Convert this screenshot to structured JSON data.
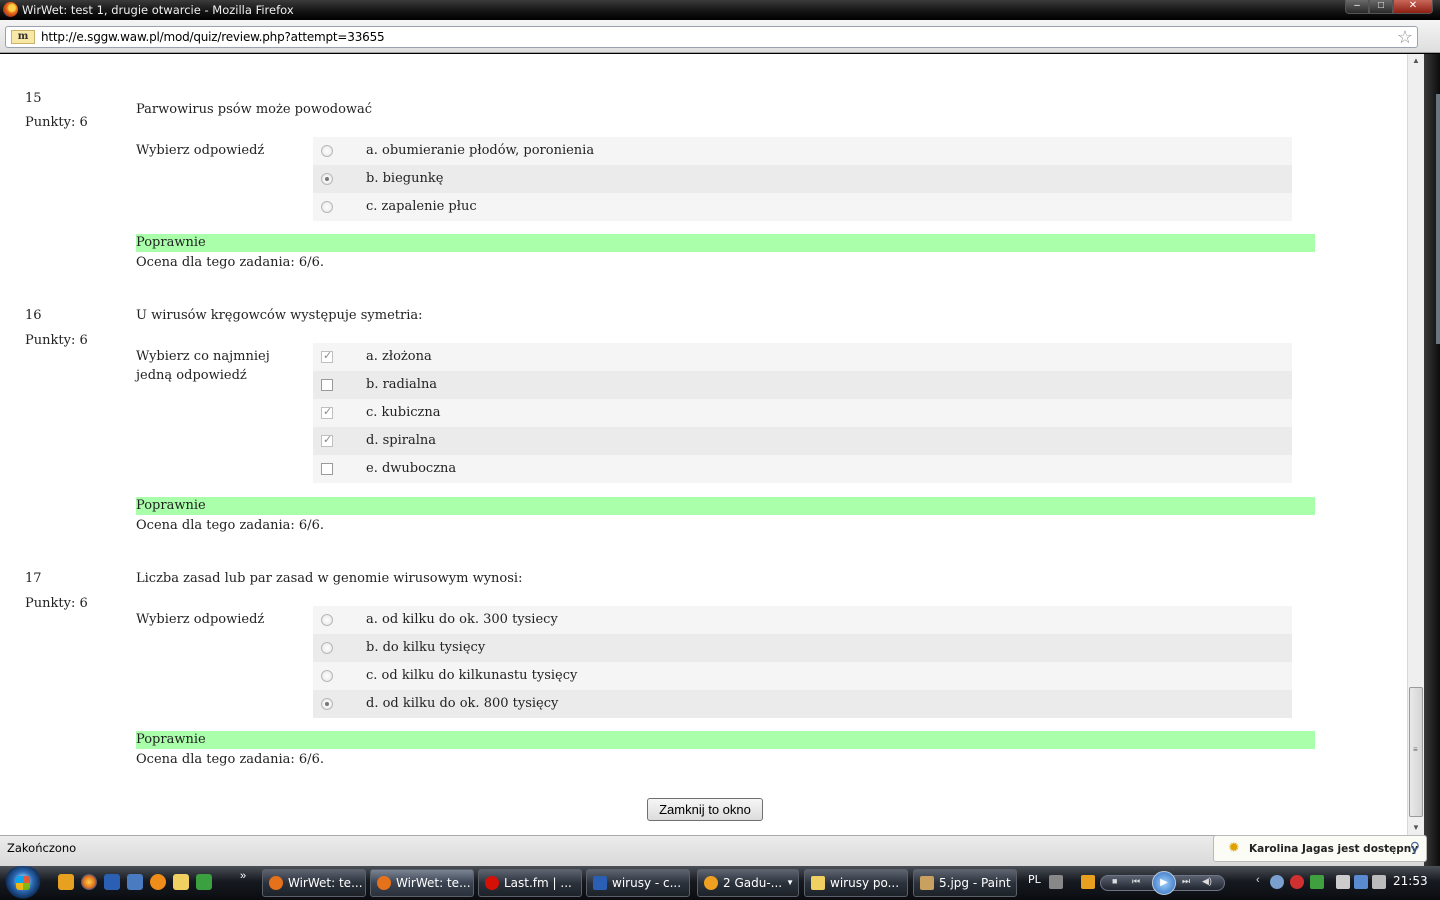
{
  "window": {
    "title": "WirWet: test 1, drugie otwarcie - Mozilla Firefox"
  },
  "address_bar": {
    "url": "http://e.sggw.waw.pl/mod/quiz/review.php?attempt=33655",
    "site_icon": "m"
  },
  "questions": [
    {
      "number": "15",
      "points": "Punkty: 6",
      "text": "Parwowirus psów może powodować",
      "prompt": "Wybierz odpowiedź",
      "type": "radio",
      "answers": [
        {
          "label": "a. obumieranie płodów, poronienia",
          "selected": false
        },
        {
          "label": "b. biegunkę",
          "selected": true
        },
        {
          "label": "c. zapalenie płuc",
          "selected": false
        }
      ],
      "feedback": "Poprawnie",
      "grade": "Ocena dla tego zadania: 6/6."
    },
    {
      "number": "16",
      "points": "Punkty: 6",
      "text": "U wirusów kręgowców występuje symetria:",
      "prompt": "Wybierz co najmniej jedną odpowiedź",
      "type": "checkbox",
      "answers": [
        {
          "label": "a. złożona",
          "selected": true
        },
        {
          "label": "b. radialna",
          "selected": false
        },
        {
          "label": "c. kubiczna",
          "selected": true
        },
        {
          "label": "d. spiralna",
          "selected": true
        },
        {
          "label": "e. dwuboczna",
          "selected": false
        }
      ],
      "feedback": "Poprawnie",
      "grade": "Ocena dla tego zadania: 6/6."
    },
    {
      "number": "17",
      "points": "Punkty: 6",
      "text": "Liczba zasad lub par zasad w genomie wirusowym wynosi:",
      "prompt": "Wybierz odpowiedź",
      "type": "radio",
      "answers": [
        {
          "label": "a. od kilku do ok. 300 tysiecy",
          "selected": false
        },
        {
          "label": "b. do kilku tysięcy",
          "selected": false
        },
        {
          "label": "c. od kilku do kilkunastu tysięcy",
          "selected": false
        },
        {
          "label": "d. od kilku do ok. 800 tysięcy",
          "selected": true
        }
      ],
      "feedback": "Poprawnie",
      "grade": "Ocena dla tego zadania: 6/6."
    }
  ],
  "close_button": "Zamknij to okno",
  "status": "Zakończono",
  "notification": "Karolina Jagas jest dostępny",
  "taskbar": {
    "buttons": [
      {
        "label": "WirWet: te...",
        "icon_color": "#e6711b",
        "active": false
      },
      {
        "label": "WirWet: te...",
        "icon_color": "#e6711b",
        "active": true
      },
      {
        "label": "Last.fm | ...",
        "icon_color": "#d51007",
        "active": false
      },
      {
        "label": "wirusy - c...",
        "icon_color": "#2b5fb3",
        "active": false
      },
      {
        "label": "2 Gadu-...",
        "icon_color": "#f0a020",
        "active": false
      },
      {
        "label": "wirusy po...",
        "icon_color": "#f0d060",
        "active": false
      },
      {
        "label": "5.jpg - Paint",
        "icon_color": "#c8a060",
        "active": false
      }
    ],
    "language": "PL",
    "clock": "21:53"
  },
  "colors": {
    "correct_bg": "#aaffaa",
    "answer_row": "#f5f5f5",
    "answer_row_alt": "#ebebeb"
  }
}
